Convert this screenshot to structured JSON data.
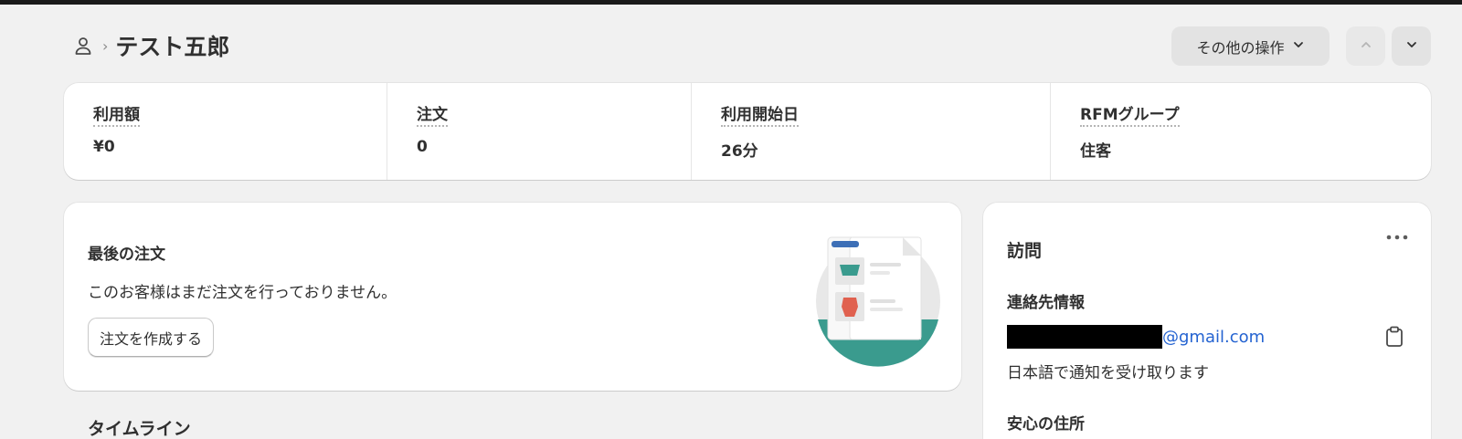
{
  "header": {
    "breadcrumb_separator": "›",
    "title": "テスト五郎",
    "more_actions_label": "その他の操作"
  },
  "stats": [
    {
      "label": "利用額",
      "value": "¥0"
    },
    {
      "label": "注文",
      "value": "0"
    },
    {
      "label": "利用開始日",
      "value": "26分"
    },
    {
      "label": "RFMグループ",
      "value": "住客"
    }
  ],
  "last_order": {
    "heading": "最後の注文",
    "empty_message": "このお客様はまだ注文を行っておりません。",
    "create_button": "注文を作成する"
  },
  "timeline": {
    "heading": "タイムライン"
  },
  "visits": {
    "title": "訪問",
    "contact_heading": "連絡先情報",
    "email_visible": "@gmail.com",
    "notification_language": "日本語で通知を受け取ります",
    "address_heading": "安心の住所"
  },
  "icons": {
    "person": "person-icon",
    "chevron_down": "chevron-down-icon",
    "chevron_up": "chevron-up-icon",
    "more": "more-horizontal-icon",
    "clipboard": "clipboard-icon"
  },
  "colors": {
    "page_bg": "#f1f1f1",
    "card_bg": "#ffffff",
    "link": "#2463d1",
    "illustration_teal": "#3a9b8e",
    "illustration_red": "#e0614f",
    "illustration_blue": "#3d6fb6"
  }
}
